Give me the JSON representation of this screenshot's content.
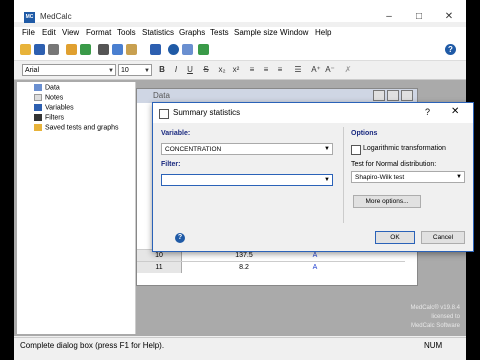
{
  "window": {
    "title": "MedCalc",
    "icon_text": "MC"
  },
  "menu": [
    "File",
    "Edit",
    "View",
    "Format",
    "Tools",
    "Statistics",
    "Graphs",
    "Tests",
    "Sample size",
    "Window",
    "Help"
  ],
  "format_bar": {
    "font": "Arial",
    "size": "10"
  },
  "tree": {
    "items": [
      "Data",
      "Notes",
      "Variables",
      "Filters",
      "Saved tests and graphs"
    ]
  },
  "data_window": {
    "title": "Data",
    "rows": [
      {
        "n": "10",
        "value": "137.5",
        "flag": "A"
      },
      {
        "n": "11",
        "value": "8.2",
        "flag": "A"
      }
    ]
  },
  "dialog": {
    "title": "Summary statistics",
    "variable_label": "Variable:",
    "variable_value": "CONCENTRATION",
    "filter_label": "Filter:",
    "filter_value": "",
    "options_label": "Options",
    "log_label": "Logarithmic transformation",
    "normal_test_label": "Test for Normal distribution:",
    "normal_test_value": "Shapiro-Wilk test",
    "more_options": "More options...",
    "ok": "OK",
    "cancel": "Cancel"
  },
  "watermark": [
    "MedCalc® v19.8.4",
    "licensed to",
    "MedCalc Software"
  ],
  "status": {
    "text": "Complete dialog box (press F1 for Help).",
    "num": "NUM"
  },
  "colors": {
    "accent": "#2a62b8",
    "label": "#1a2a80",
    "flag": "#1f3fd0"
  }
}
